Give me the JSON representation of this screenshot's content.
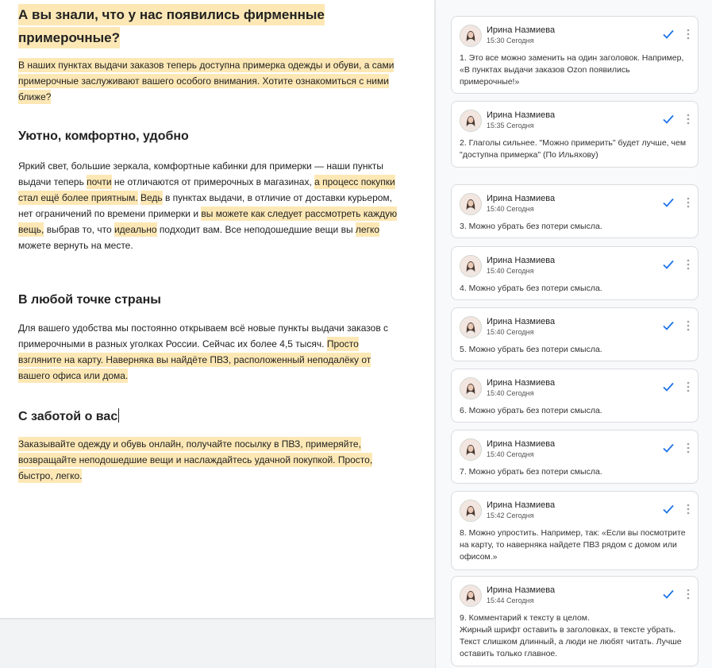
{
  "document": {
    "title": "А вы знали, что у нас появились фирменные примерочные?",
    "intro": "В наших пунктах выдачи заказов теперь доступна примерка одежды и обуви, а сами примерочные заслуживают вашего особого внимания. Хотите ознакомиться с ними ближе?",
    "section1": {
      "heading": "Уютно, комфортно, удобно",
      "s1": "Яркий свет, большие зеркала, комфортные кабинки для примерки — наши пункты выдачи теперь ",
      "h1": "почти",
      "s2": " не отличаются от примерочных в магазинах, ",
      "h2": "а процесс покупки стал ещё более приятным.",
      "s3": " ",
      "h3": "Ведь",
      "s4": " в пунктах выдачи, в отличие от доставки курьером, нет ограничений по времени примерки и ",
      "h4": "вы можете как следует рассмотреть каждую вещь,",
      "s5": " выбрав то, что ",
      "h5": "идеально",
      "s6": " подходит вам. Все неподошедшие вещи вы ",
      "h6": "легко",
      "s7": " можете вернуть на месте."
    },
    "section2": {
      "heading": "В любой точке страны",
      "s1": "Для вашего удобства мы постоянно открываем всё новые пункты выдачи заказов с примерочными в разных уголках России. Сейчас их более 4,5 тысяч. ",
      "h1": "Просто взгляните на карту. Наверняка вы найдёте ПВЗ, расположенный неподалёку от вашего офиса или дома."
    },
    "section3": {
      "heading": "С заботой о вас",
      "body": "Заказывайте одежду и обувь онлайн, получайте посылку в ПВЗ, примеряйте, возвращайте неподошедшие вещи и наслаждайтесь удачной покупкой. Просто, быстро, легко."
    }
  },
  "comments": [
    {
      "author": "Ирина Назмиева",
      "time": "15:30 Сегодня",
      "text": "1. Это все можно заменить на один заголовок. Например, «В пунктах выдачи заказов Ozon появились примерочные!»"
    },
    {
      "author": "Ирина Назмиева",
      "time": "15:35 Сегодня",
      "text": "2. Глаголы сильнее.  \"Можно примерить\" будет лучше, чем \"доступна примерка\" (По Ильяхову)"
    },
    {
      "author": "Ирина Назмиева",
      "time": "15:40 Сегодня",
      "text": "3. Можно убрать без потери смысла."
    },
    {
      "author": "Ирина Назмиева",
      "time": "15:40 Сегодня",
      "text": "4. Можно убрать без потери смысла."
    },
    {
      "author": "Ирина Назмиева",
      "time": "15:40 Сегодня",
      "text": "5. Можно убрать без потери смысла."
    },
    {
      "author": "Ирина Назмиева",
      "time": "15:40 Сегодня",
      "text": "6. Можно убрать без потери смысла."
    },
    {
      "author": "Ирина Назмиева",
      "time": "15:40 Сегодня",
      "text": "7. Можно убрать без потери смысла."
    },
    {
      "author": "Ирина Назмиева",
      "time": "15:42 Сегодня",
      "text": "8. Можно упростить. Например, так: «Если вы посмотрите на карту, то наверняка найдете ПВЗ рядом с домом или офисом.»"
    },
    {
      "author": "Ирина Назмиева",
      "time": "15:44 Сегодня",
      "text": "9. Комментарий к тексту в целом.\nЖирный шрифт оставить в заголовках, в тексте убрать. Текст слишком длинный, а люди не любят читать. Лучше оставить только главное."
    }
  ],
  "colors": {
    "highlight": "#fde8b5",
    "check": "#1a73e8"
  },
  "icons": {
    "resolve": "check-icon",
    "menu": "more-vert-icon",
    "avatar": "avatar"
  }
}
